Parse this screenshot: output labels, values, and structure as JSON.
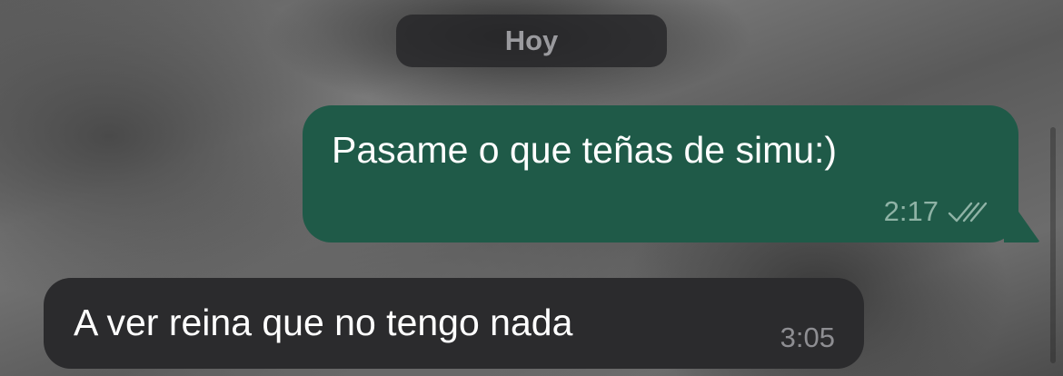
{
  "date_separator": {
    "label": "Hoy"
  },
  "messages": [
    {
      "direction": "outgoing",
      "text": "Pasame o que teñas de simu:)",
      "time": "2:17",
      "status_icon": "double-check-icon"
    },
    {
      "direction": "incoming",
      "text": "A ver reina que no tengo nada",
      "time": "3:05"
    }
  ],
  "colors": {
    "outgoing_bubble": "#1f5a48",
    "incoming_bubble": "#2b2b2d",
    "date_pill": "#262628",
    "message_text": "#ffffff",
    "outgoing_meta": "#8fb3a6",
    "incoming_meta": "#8e8e92"
  }
}
